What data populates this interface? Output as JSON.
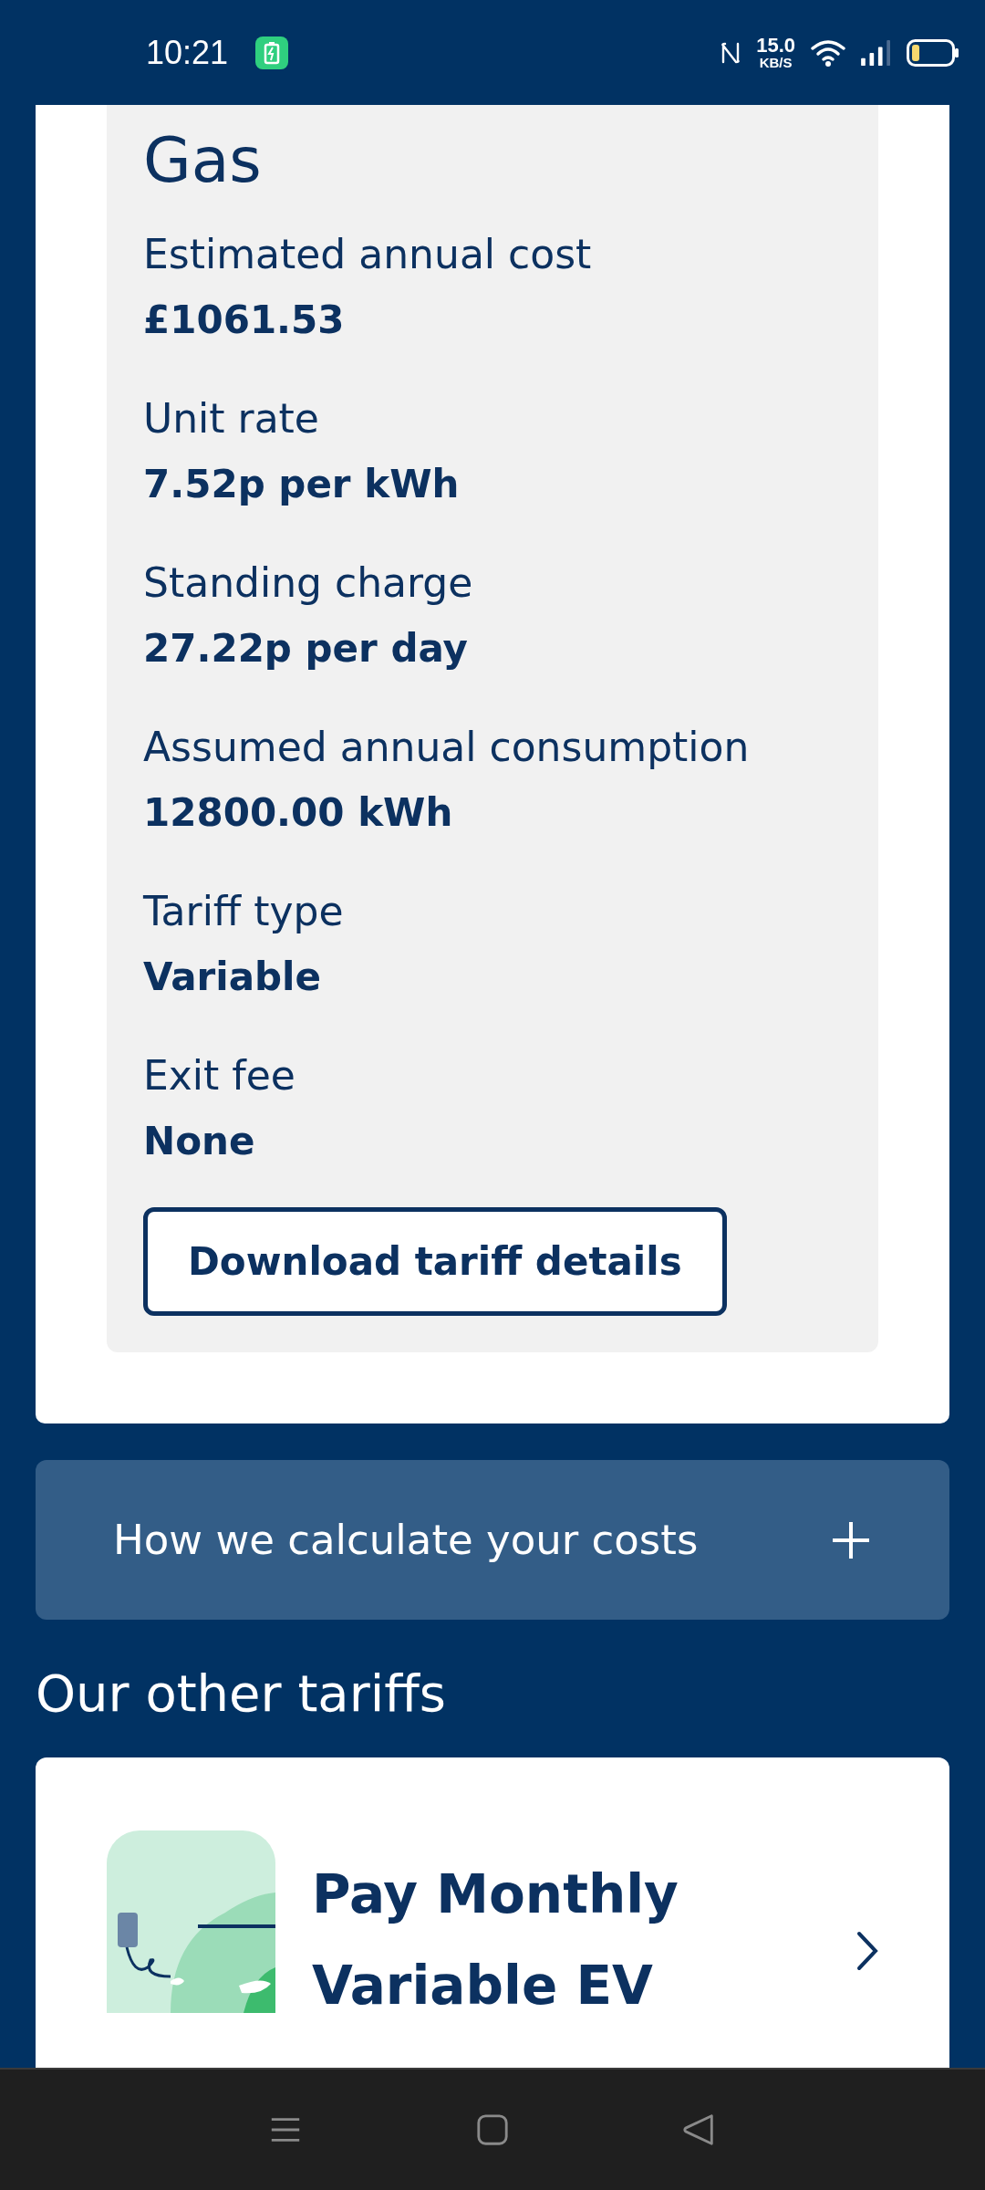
{
  "status_bar": {
    "time": "10:21",
    "speed_value": "15.0",
    "speed_unit": "KB/S"
  },
  "tariff": {
    "title": "Gas",
    "details": [
      {
        "label": "Estimated annual cost",
        "value": "£1061.53"
      },
      {
        "label": "Unit rate",
        "value": "7.52p per kWh"
      },
      {
        "label": "Standing charge",
        "value": "27.22p per day"
      },
      {
        "label": "Assumed annual consumption",
        "value": "12800.00 kWh"
      },
      {
        "label": "Tariff type",
        "value": "Variable"
      },
      {
        "label": "Exit fee",
        "value": "None"
      }
    ],
    "button": "Download tariff details"
  },
  "accordion": {
    "title": "How we calculate your costs",
    "expanded": false
  },
  "other_tariffs": {
    "heading": "Our other tariffs",
    "cards": [
      {
        "title": "Pay Monthly Variable EV"
      }
    ]
  }
}
